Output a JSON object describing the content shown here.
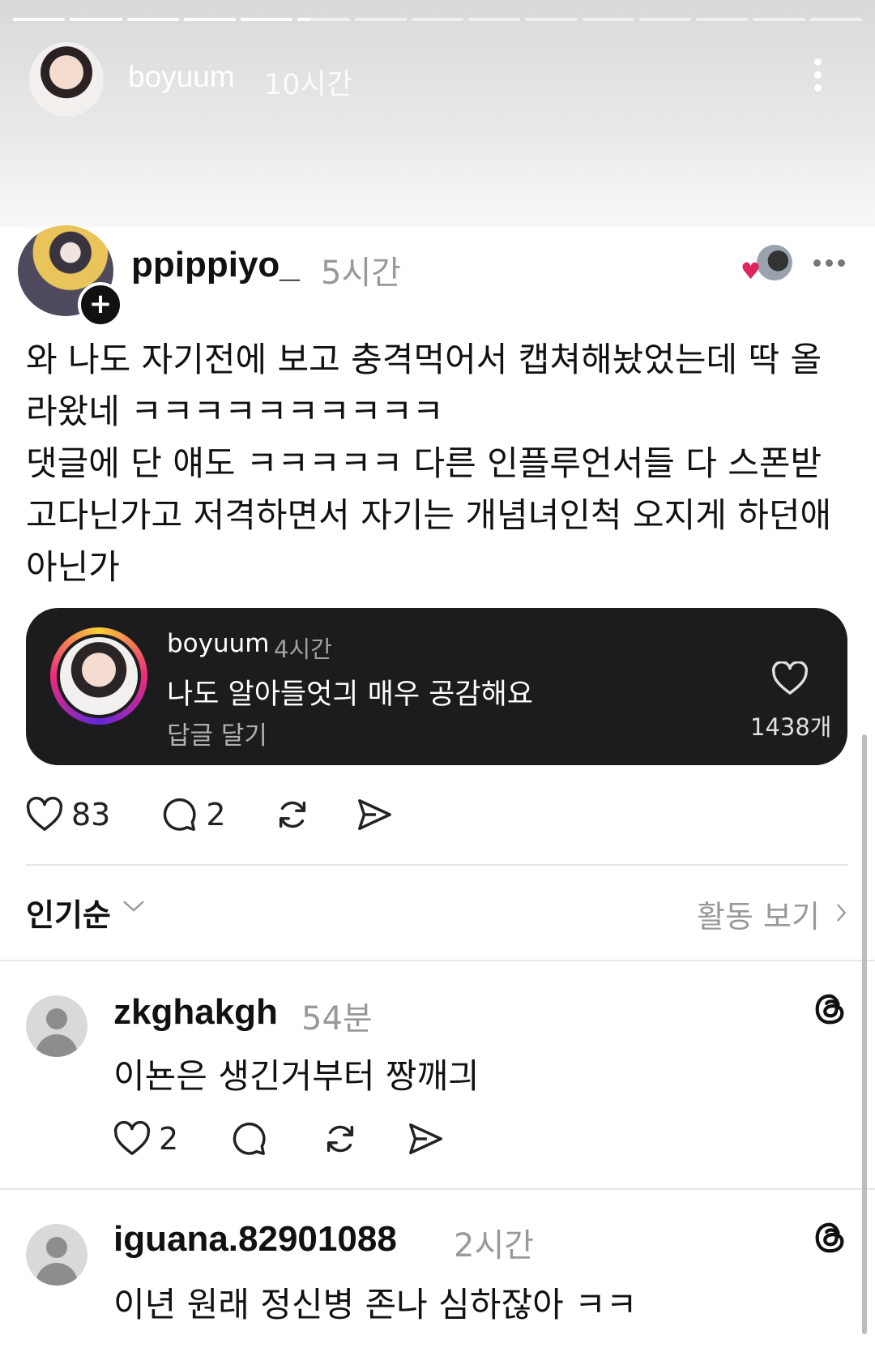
{
  "story": {
    "username": "boyuum",
    "time": "10시간",
    "progress": {
      "segments": 15,
      "completed": 5,
      "current_fraction": 0.25
    }
  },
  "post": {
    "username": "ppippiyo_",
    "time": "5시간",
    "body": "와 나도 자기전에 보고 충격먹어서 캡쳐해놨었는데 딱 올\n라왔네 ㅋㅋㅋㅋㅋㅋㅋㅋㅋㅋ\n댓글에 단 얘도 ㅋㅋㅋㅋㅋ 다른 인플루언서들 다 스폰받\n고다닌가고 저격하면서 자기는 개념녀인척 오지게 하던애\n아닌가",
    "quoted_comment": {
      "username": "boyuum",
      "time": "4시간",
      "text": "나도 알아들엇긔 매우 공감해요",
      "reply_label": "답글 달기",
      "likes": "1438개"
    },
    "likes": "83",
    "comments": "2"
  },
  "sort": {
    "label": "인기순",
    "activity_label": "활동 보기"
  },
  "replies": [
    {
      "username": "zkghakgh",
      "time": "54분",
      "text": "이뇬은 생긴거부터 짱깨긔",
      "likes": "2"
    },
    {
      "username": "iguana.82901088",
      "time": "2시간",
      "text": "이년 원래 정신병 존나 심하잖아 ㅋㅋ"
    }
  ],
  "colors": {
    "heart_red": "#e0245e",
    "card_bg": "#1c1c1e",
    "muted_text": "#999999"
  },
  "icons": [
    "more-icon",
    "plus-icon",
    "heart-icon",
    "comment-icon",
    "repost-icon",
    "share-icon",
    "chevron-down-icon",
    "chevron-right-icon",
    "threads-icon"
  ]
}
